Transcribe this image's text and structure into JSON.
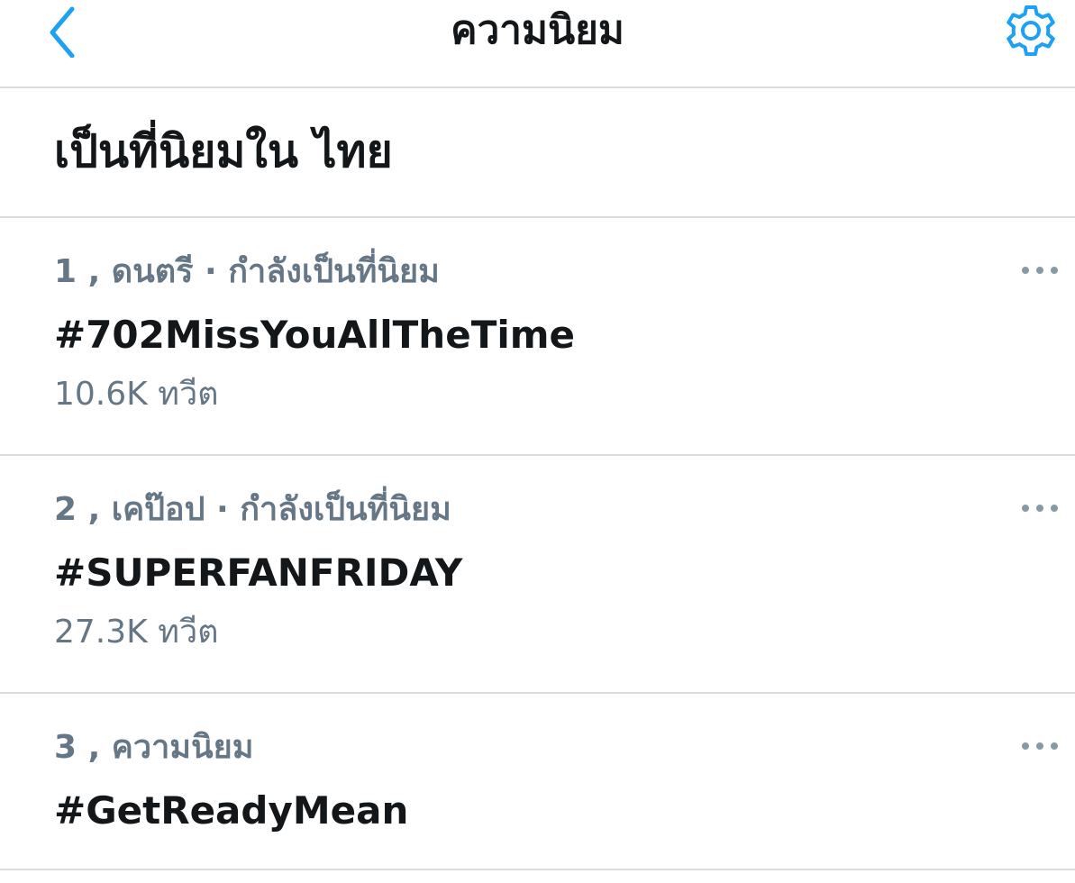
{
  "header": {
    "title": "ความนิยม",
    "back_icon": "chevron-left-icon",
    "settings_icon": "gear-icon"
  },
  "section": {
    "title": "เป็นที่นิยมใน ไทย"
  },
  "trends": [
    {
      "meta": "1 , ดนตรี · กำลังเป็นที่นิยม",
      "name": "#702MissYouAllTheTime",
      "count": "10.6K ทวีต"
    },
    {
      "meta": "2 , เคป๊อป · กำลังเป็นที่นิยม",
      "name": "#SUPERFANFRIDAY",
      "count": "27.3K ทวีต"
    },
    {
      "meta": "3 , ความนิยม",
      "name": "#GetReadyMean",
      "count": ""
    }
  ],
  "more_icon": "more-horizontal-icon",
  "colors": {
    "accent": "#1da1f2",
    "primary_text": "#14171a",
    "secondary_text": "#657786",
    "divider": "#d9dde0"
  }
}
